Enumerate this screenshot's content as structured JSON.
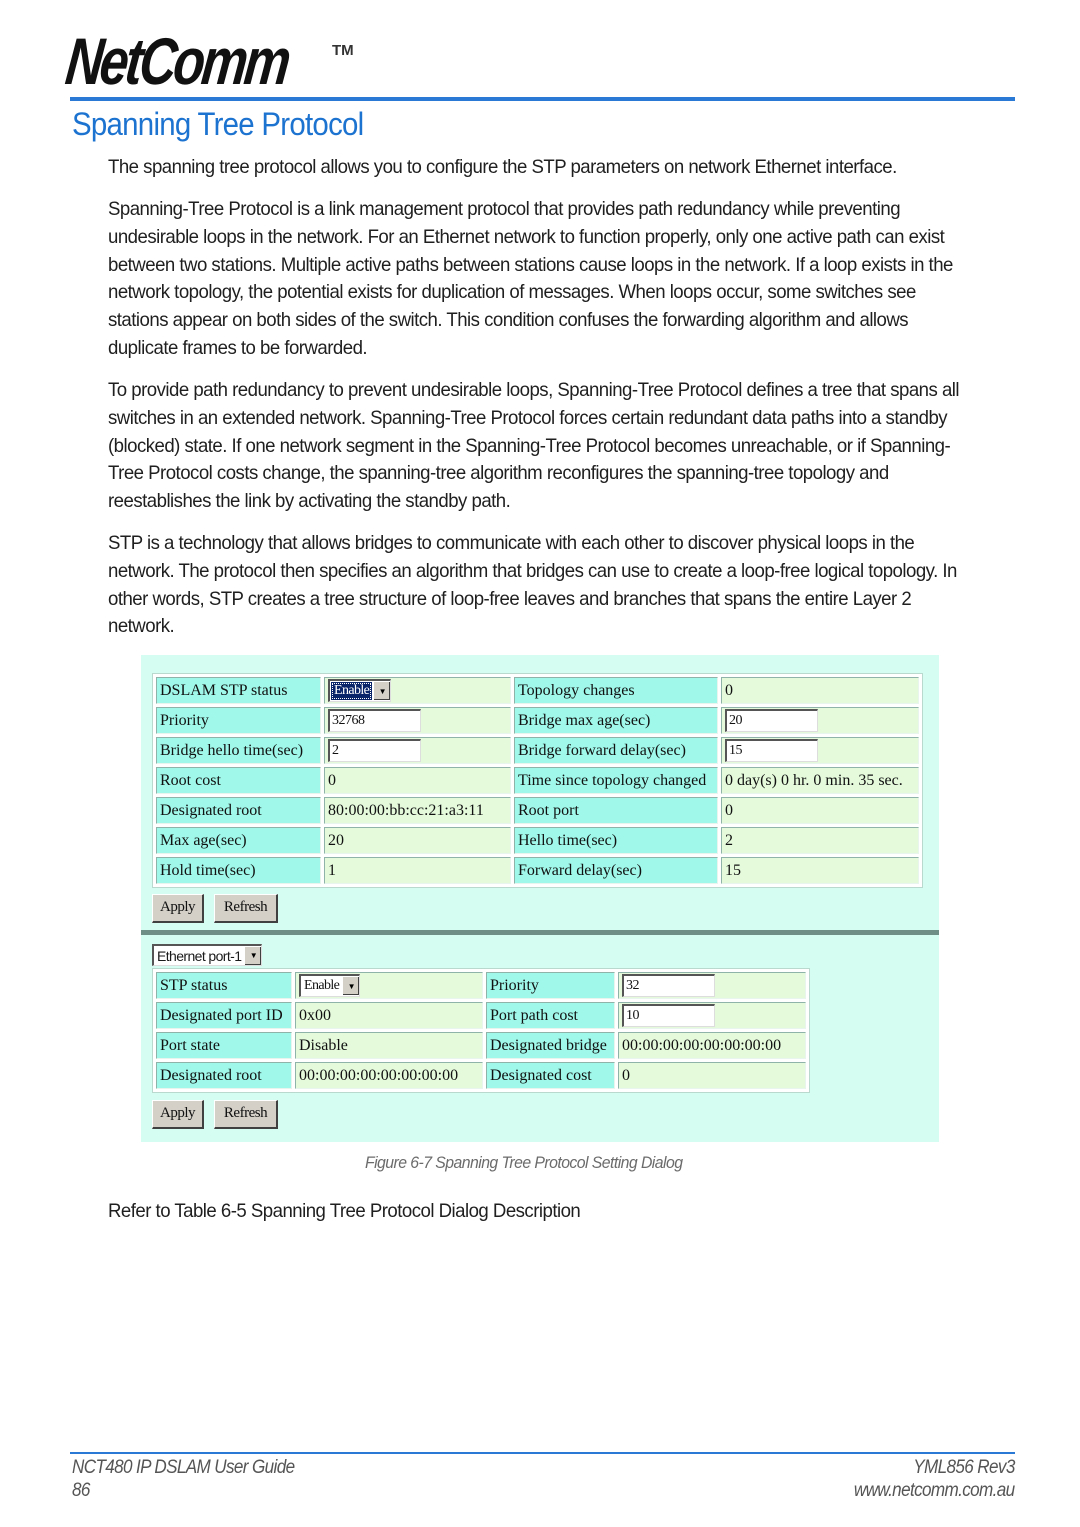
{
  "header": {
    "logo_text": "NetComm",
    "logo_tm": "TM",
    "title": "Spanning Tree Protocol",
    "accent_color": "#1d73d0"
  },
  "paragraphs": [
    "The spanning tree protocol allows you to configure the STP parameters on network Ethernet interface.",
    "Spanning-Tree Protocol is a link management protocol that provides path redundancy while preventing undesirable loops in the network. For an Ethernet network to function properly, only one active path can exist between two stations. Multiple active paths between stations cause loops in the network. If a loop exists in the network topology, the potential exists for duplication of messages. When loops occur, some switches see stations appear on both sides of the switch. This condition confuses the forwarding algorithm and allows duplicate frames to be forwarded.",
    "To provide path redundancy to prevent undesirable loops, Spanning-Tree Protocol defines a tree that spans all switches in an extended network. Spanning-Tree Protocol forces certain redundant data paths into a standby (blocked) state. If one network segment in the Spanning-Tree Protocol becomes unreachable, or if Spanning-Tree Protocol costs change, the spanning-tree algorithm reconfigures the spanning-tree topology and reestablishes the link by activating the standby path.",
    "STP is a technology that allows bridges to communicate with each other to discover physical loops in the network. The protocol then specifies an algorithm that bridges can use to create a loop-free logical topology. In other words, STP creates a tree structure of loop-free leaves and branches that spans the entire Layer 2 network."
  ],
  "dialog": {
    "bridge": {
      "rows": [
        {
          "label1": "DSLAM STP status",
          "value1": "Enable",
          "label2": "Topology changes",
          "value2": "0"
        },
        {
          "label1": "Priority",
          "value1": "32768",
          "label2": "Bridge max age(sec)",
          "value2": "20"
        },
        {
          "label1": "Bridge hello time(sec)",
          "value1": "2",
          "label2": "Bridge forward delay(sec)",
          "value2": "15"
        },
        {
          "label1": "Root cost",
          "value1": "0",
          "label2": "Time since topology changed",
          "value2": "0 day(s) 0 hr. 0 min. 35 sec."
        },
        {
          "label1": "Designated root",
          "value1": "80:00:00:bb:cc:21:a3:11",
          "label2": "Root port",
          "value2": "0"
        },
        {
          "label1": "Max age(sec)",
          "value1": "20",
          "label2": "Hello time(sec)",
          "value2": "2"
        },
        {
          "label1": "Hold time(sec)",
          "value1": "1",
          "label2": "Forward delay(sec)",
          "value2": "15"
        }
      ],
      "apply_label": "Apply",
      "refresh_label": "Refresh"
    },
    "port": {
      "selected_port": "Ethernet port-1",
      "rows": [
        {
          "label1": "STP status",
          "value1": "Enable",
          "label2": "Priority",
          "value2": "32"
        },
        {
          "label1": "Designated port ID",
          "value1": "0x00",
          "label2": "Port path cost",
          "value2": "10"
        },
        {
          "label1": "Port state",
          "value1": "Disable",
          "label2": "Designated bridge",
          "value2": "00:00:00:00:00:00:00:00"
        },
        {
          "label1": "Designated root",
          "value1": "00:00:00:00:00:00:00:00",
          "label2": "Designated cost",
          "value2": "0"
        }
      ],
      "apply_label": "Apply",
      "refresh_label": "Refresh"
    },
    "colors": {
      "background": "#d6fdf2",
      "label_cell": "#9ff8ea",
      "value_cell": "#e4fadb"
    }
  },
  "caption": "Figure 6-7 Spanning Tree Protocol Setting Dialog",
  "refer_text": "Refer to Table 6-5 Spanning Tree Protocol Dialog Description",
  "footer": {
    "guide_title": "NCT480 IP DSLAM User Guide",
    "page_number": "86",
    "doc_code": "YML856 Rev3",
    "website": "www.netcomm.com.au"
  }
}
